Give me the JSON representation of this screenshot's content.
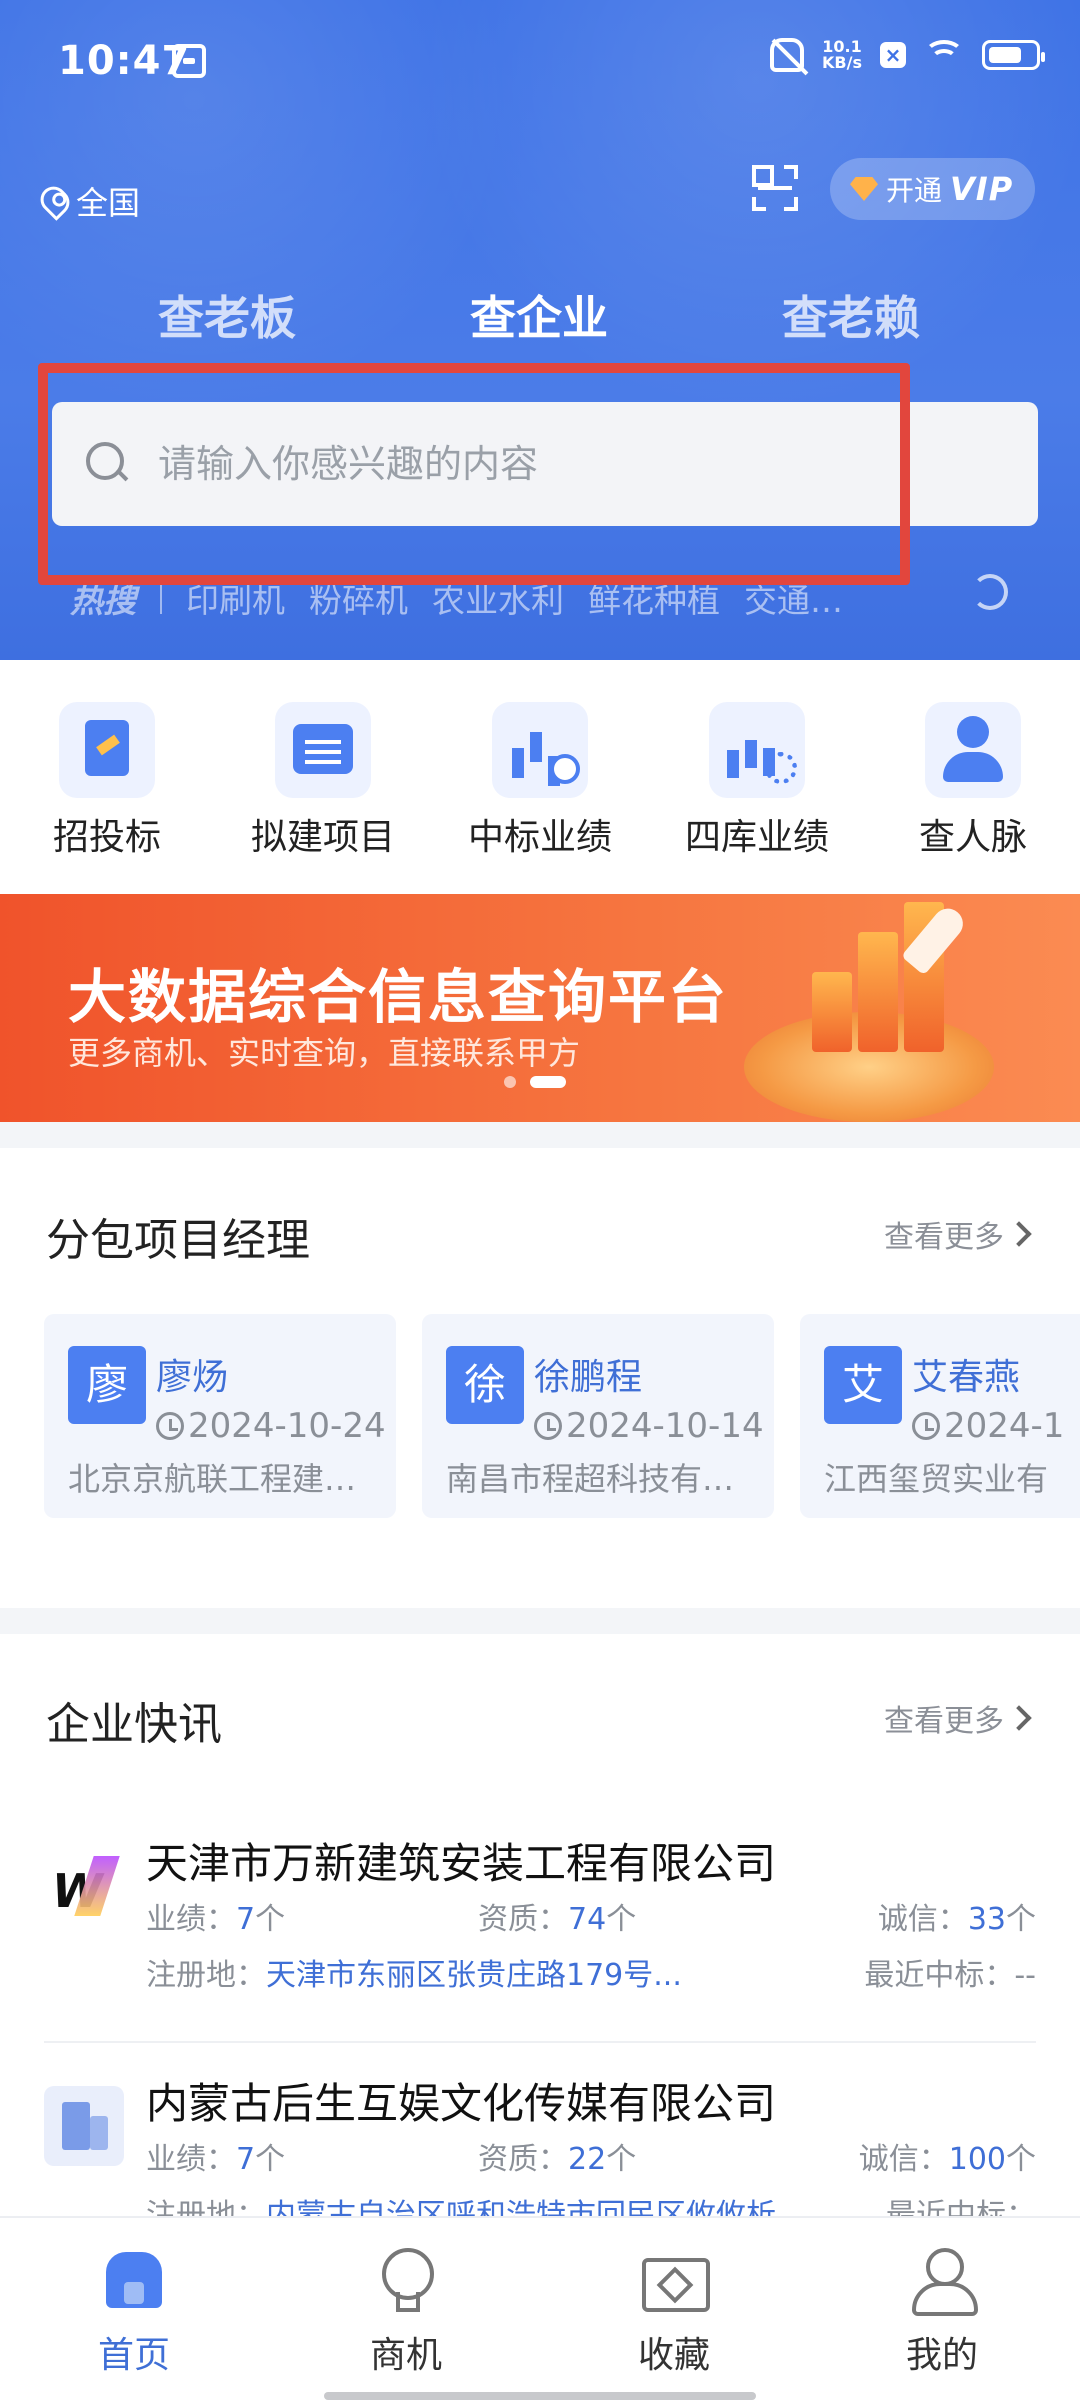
{
  "status_bar": {
    "time": "10:47",
    "net_speed": "10.1",
    "net_unit": "KB/s"
  },
  "header": {
    "location": "全国",
    "vip_label": "开通",
    "vip_badge": "VIP",
    "tabs": [
      {
        "label": "查老板",
        "active": false
      },
      {
        "label": "查企业",
        "active": true
      },
      {
        "label": "查老赖",
        "active": false
      }
    ],
    "search_placeholder": "请输入你感兴趣的内容",
    "hot_label": "热搜",
    "hot_terms": [
      "印刷机",
      "粉碎机",
      "农业水利",
      "鲜花种植",
      "交通…"
    ]
  },
  "quick_actions": [
    {
      "label": "招投标",
      "icon": "bidding-icon"
    },
    {
      "label": "拟建项目",
      "icon": "planned-project-icon"
    },
    {
      "label": "中标业绩",
      "icon": "winning-bid-icon"
    },
    {
      "label": "四库业绩",
      "icon": "four-library-icon"
    },
    {
      "label": "查人脉",
      "icon": "contacts-icon"
    }
  ],
  "banner": {
    "title": "大数据综合信息查询平台",
    "subtitle": "更多商机、实时查询，直接联系甲方",
    "active_dot": 2,
    "dot_count": 2
  },
  "subcontract": {
    "title": "分包项目经理",
    "more_label": "查看更多",
    "cards": [
      {
        "initial": "廖",
        "name": "廖炀",
        "date": "2024-10-24",
        "company": "北京京航联工程建…"
      },
      {
        "initial": "徐",
        "name": "徐鹏程",
        "date": "2024-10-14",
        "company": "南昌市程超科技有…"
      },
      {
        "initial": "艾",
        "name": "艾春燕",
        "date": "2024-1",
        "company": "江西玺贸实业有"
      }
    ]
  },
  "news": {
    "title": "企业快讯",
    "more_label": "查看更多",
    "labels": {
      "performance": "业绩：",
      "qualification": "资质：",
      "credit": "诚信：",
      "reg_address": "注册地：",
      "recent_bid": "最近中标："
    },
    "items": [
      {
        "name": "天津市万新建筑安装工程有限公司",
        "performance": "7",
        "qualification": "74",
        "credit": "33",
        "unit": "个",
        "address": "天津市东丽区张贵庄路179号...",
        "recent_bid": "--"
      },
      {
        "name": "内蒙古后生互娱文化传媒有限公司",
        "performance": "7",
        "qualification": "22",
        "credit": "100",
        "unit": "个",
        "address": "内蒙古自治区呼和浩特市回民区攸攸析",
        "recent_bid": ""
      }
    ]
  },
  "tabbar": [
    {
      "label": "首页",
      "active": true
    },
    {
      "label": "商机",
      "active": false
    },
    {
      "label": "收藏",
      "active": false
    },
    {
      "label": "我的",
      "active": false
    }
  ],
  "colors": {
    "primary": "#4c7ff1",
    "hero": "#3f73e6",
    "highlight_box": "#e2463d",
    "banner": "#f0532b"
  }
}
